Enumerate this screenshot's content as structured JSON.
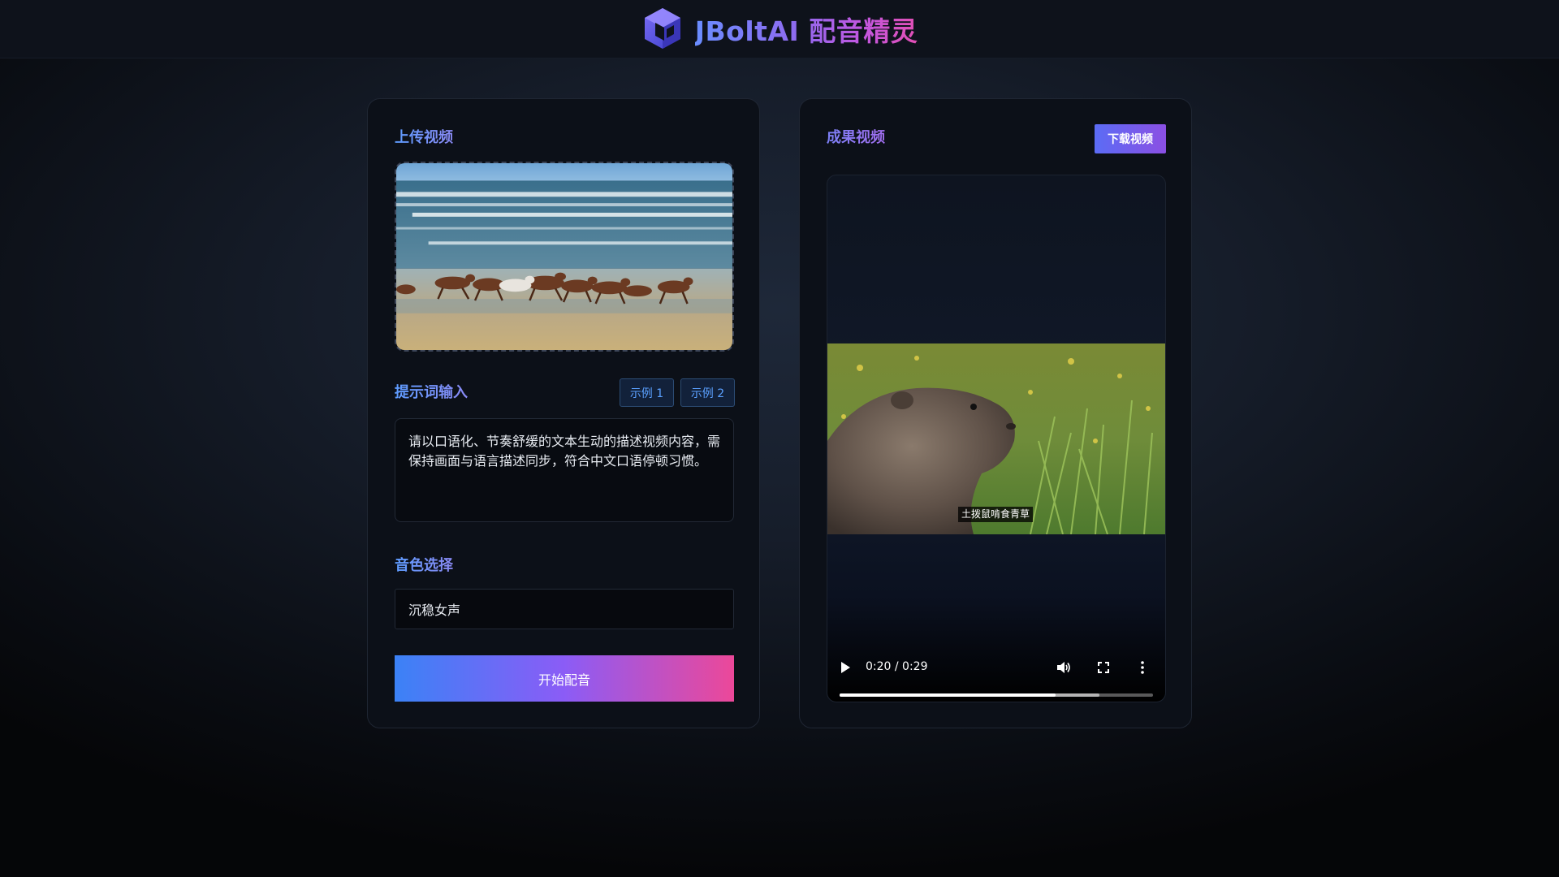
{
  "header": {
    "brand_name": "JBoltAI 配音精灵",
    "logo_icon": "cube-logo-icon"
  },
  "upload": {
    "title": "上传视频",
    "preview_icon": "video-thumbnail-horses"
  },
  "prompt": {
    "title": "提示词输入",
    "example_1_label": "示例 1",
    "example_2_label": "示例 2",
    "text": "请以口语化、节奏舒缓的文本生动的描述视频内容，需保持画面与语言描述同步，符合中文口语停顿习惯。"
  },
  "voice": {
    "title": "音色选择",
    "selected": "沉稳女声"
  },
  "start_button_label": "开始配音",
  "result": {
    "title": "成果视频",
    "download_label": "下载视频",
    "subtitle": "土拨鼠啃食青草",
    "time_display": "0:20 / 0:29",
    "progress_fraction": 0.69,
    "buffered_fraction": 0.83
  },
  "colors": {
    "accent_blue": "#3b82f6",
    "accent_purple": "#8b5cf6",
    "accent_pink": "#ec4899",
    "example_text": "#5aa0ff"
  }
}
